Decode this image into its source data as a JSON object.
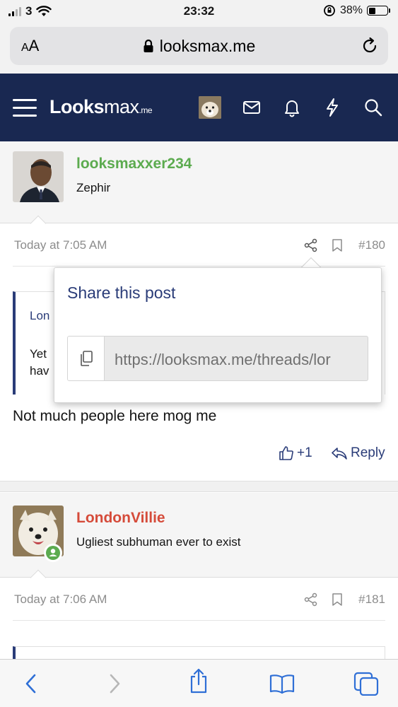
{
  "status_bar": {
    "carrier": "3",
    "time": "23:32",
    "battery": "38%",
    "battery_level": 0.38
  },
  "browser": {
    "aa_label_small": "A",
    "aa_label_large": "A",
    "url": "looksmax.me"
  },
  "site": {
    "logo_bold": "Lo",
    "logo_mid": "oks",
    "logo_light": "max",
    "logo_suffix": ".me",
    "nav_icons": [
      "mail-icon",
      "bell-icon",
      "lightning-icon",
      "search-icon"
    ]
  },
  "posts": [
    {
      "username": "looksmaxxer234",
      "user_title": "Zephir",
      "username_color": "#5cab4f",
      "date": "Today at 7:05 AM",
      "number": "#180",
      "quote_author": "Lon",
      "quote_line1": "Yet",
      "quote_line2": "hav",
      "body": "Not much people here mog me",
      "reaction_count": "+1",
      "reply_label": "Reply"
    },
    {
      "username": "LondonVillie",
      "user_title": "Ugliest subhuman ever to exist",
      "username_color": "#d54b3a",
      "date": "Today at 7:06 AM",
      "number": "#181"
    }
  ],
  "share_popup": {
    "title": "Share this post",
    "url": "https://looksmax.me/threads/lor"
  },
  "colors": {
    "nav_bg": "#192851",
    "accent": "#2a3c78",
    "safari_blue": "#2f6fd6"
  }
}
